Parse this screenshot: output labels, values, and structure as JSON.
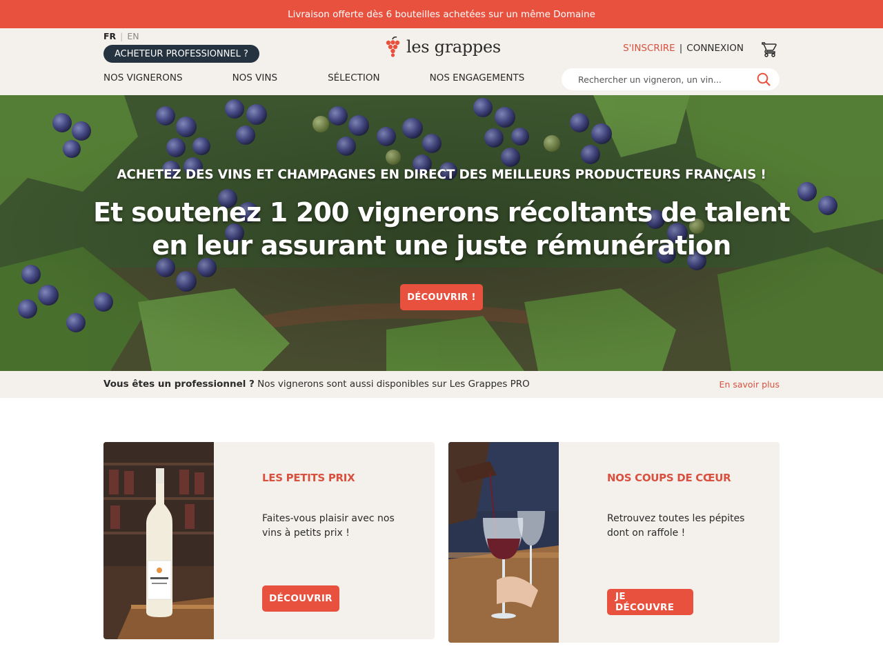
{
  "promo": {
    "text": "Livraison offerte dès 6 bouteilles achetées sur un même Domaine"
  },
  "header": {
    "lang_fr": "FR",
    "lang_en": "EN",
    "pro_button": "ACHETEUR PROFESSIONNEL ?",
    "logo_text": "les grappes",
    "signup": "S'INSCRIRE",
    "separator": "|",
    "login": "CONNEXION",
    "nav": [
      "NOS VIGNERONS",
      "NOS VINS",
      "SÉLECTION",
      "NOS ENGAGEMENTS"
    ],
    "search_placeholder": "Rechercher un vigneron, un vin..."
  },
  "hero": {
    "subtitle": "ACHETEZ DES VINS ET CHAMPAGNES EN DIRECT DES MEILLEURS PRODUCTEURS FRANÇAIS !",
    "title_line1": "Et soutenez 1 200 vignerons récoltants de talent",
    "title_line2": "en leur assurant une juste rémunération",
    "cta": "DÉCOUVRIR !"
  },
  "pro_band": {
    "bold": "Vous êtes un professionnel ?",
    "text": " Nos vignerons sont aussi disponibles sur Les Grappes PRO",
    "link": "En savoir plus"
  },
  "cards": [
    {
      "title": "LES PETITS PRIX",
      "description": "Faites-vous plaisir avec nos vins à petits prix !",
      "button": "DÉCOUVRIR"
    },
    {
      "title": "NOS COUPS DE CŒUR",
      "description": "Retrouvez toutes les pépites dont on raffole !",
      "button": "JE DÉCOUVRE"
    }
  ],
  "colors": {
    "accent": "#e9513f",
    "dark_pill": "#253341",
    "beige": "#f4f1ec"
  },
  "icons": {
    "logo": "grape-cluster-icon",
    "cart": "cart-icon",
    "search": "search-icon"
  }
}
